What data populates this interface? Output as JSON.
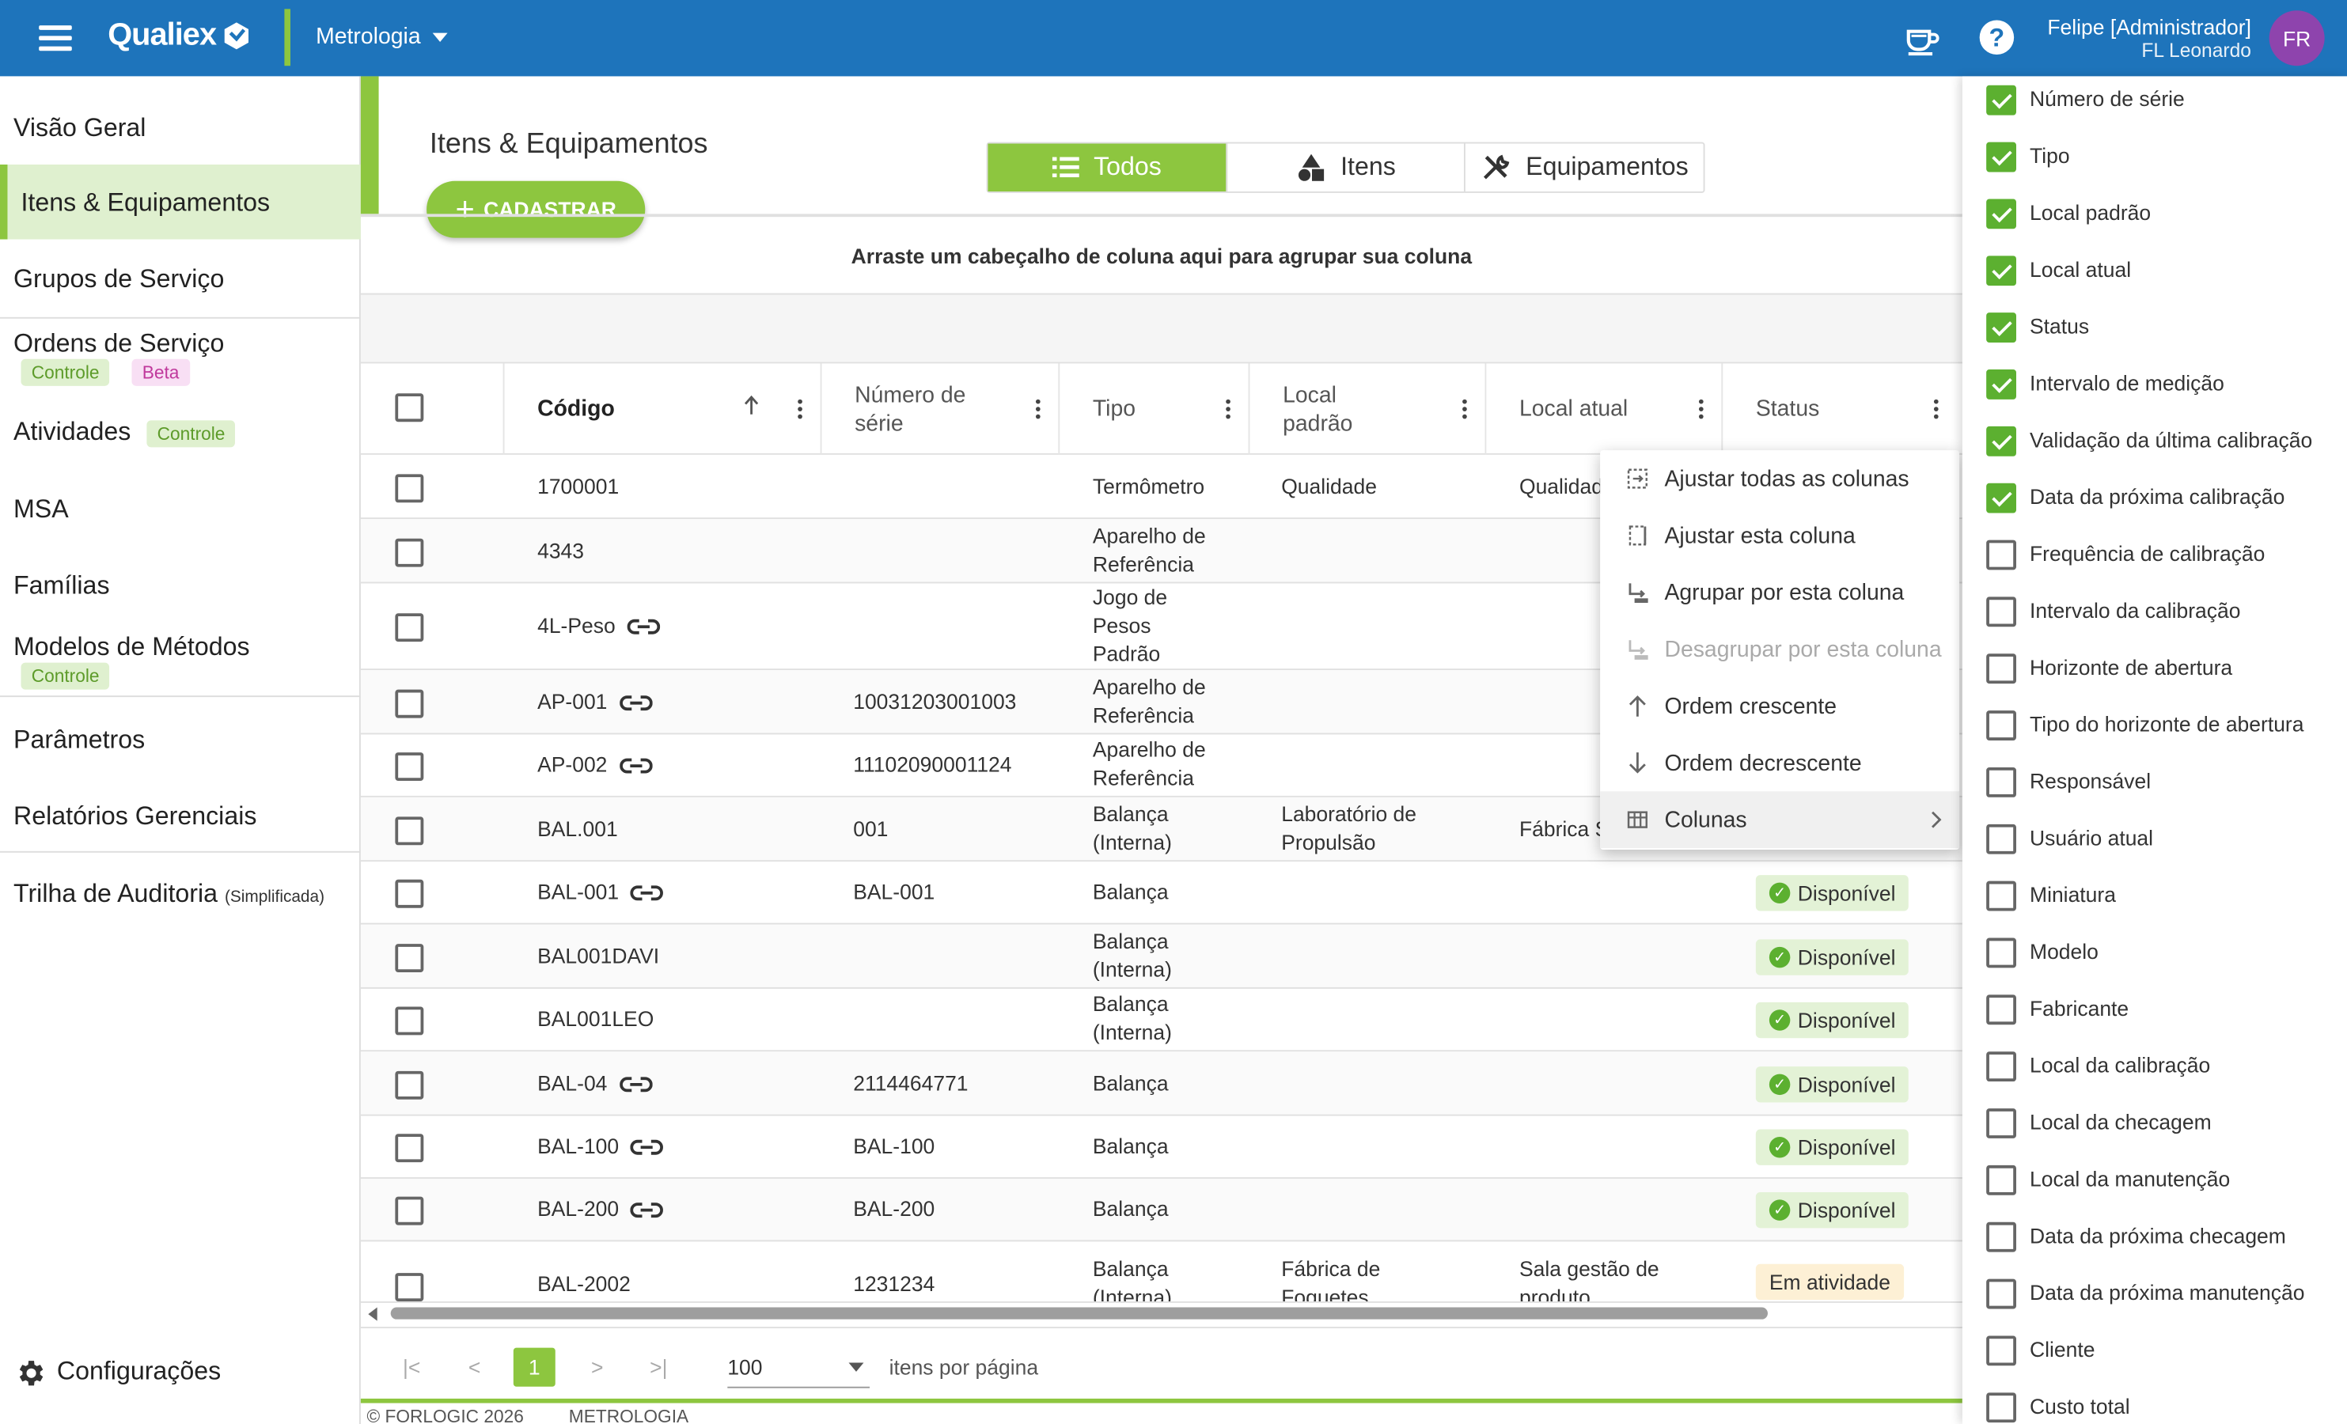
{
  "header": {
    "logo": "Qualiex",
    "module": "Metrologia",
    "user_name": "Felipe [Administrador]",
    "user_sub": "FL Leonardo",
    "avatar": "FR"
  },
  "sidebar": {
    "items": [
      {
        "label": "Visão Geral"
      },
      {
        "label": "Itens & Equipamentos"
      },
      {
        "label": "Grupos de Serviço"
      },
      {
        "label": "Ordens de Serviço",
        "tags": [
          "Controle",
          "Beta"
        ]
      },
      {
        "label": "Atividades",
        "tags": [
          "Controle"
        ]
      },
      {
        "label": "MSA"
      },
      {
        "label": "Famílias"
      },
      {
        "label": "Modelos de Métodos",
        "tags": [
          "Controle"
        ]
      },
      {
        "label": "Parâmetros"
      },
      {
        "label": "Relatórios Gerenciais"
      },
      {
        "label": "Trilha de Auditoria",
        "suffix": "(Simplificada)"
      }
    ],
    "settings": "Configurações"
  },
  "page": {
    "title": "Itens & Equipamentos",
    "add_button": "CADASTRAR",
    "toggle": [
      "Todos",
      "Itens",
      "Equipamentos"
    ],
    "group_hint": "Arraste um cabeçalho de coluna aqui para agrupar sua coluna"
  },
  "table": {
    "columns": [
      "Código",
      "Número de série",
      "Tipo",
      "Local padrão",
      "Local atual",
      "Status"
    ],
    "rows": [
      {
        "codigo": "1700001",
        "serie": "",
        "tipo": "Termômetro",
        "local_padrao": "Qualidade",
        "local_atual": "Qualidade",
        "status": ""
      },
      {
        "codigo": "4343",
        "serie": "",
        "tipo": "Aparelho de Referência",
        "local_padrao": "",
        "local_atual": "",
        "status": ""
      },
      {
        "codigo": "4L-Peso",
        "serie": "",
        "tipo": "Jogo de Pesos Padrão",
        "local_padrao": "",
        "local_atual": "",
        "status": ""
      },
      {
        "codigo": "AP-001",
        "serie": "10031203001003",
        "tipo": "Aparelho de Referência",
        "local_padrao": "",
        "local_atual": "",
        "status": ""
      },
      {
        "codigo": "AP-002",
        "serie": "11102090001124",
        "tipo": "Aparelho de Referência",
        "local_padrao": "",
        "local_atual": "",
        "status": ""
      },
      {
        "codigo": "BAL.001",
        "serie": "001",
        "tipo": "Balança (Interna)",
        "local_padrao": "Laboratório de Propulsão",
        "local_atual": "Fábrica S",
        "status": ""
      },
      {
        "codigo": "BAL-001",
        "serie": "BAL-001",
        "tipo": "Balança",
        "local_padrao": "",
        "local_atual": "",
        "status": "Disponível"
      },
      {
        "codigo": "BAL001DAVI",
        "serie": "",
        "tipo": "Balança (Interna)",
        "local_padrao": "",
        "local_atual": "",
        "status": "Disponível"
      },
      {
        "codigo": "BAL001LEO",
        "serie": "",
        "tipo": "Balança (Interna)",
        "local_padrao": "",
        "local_atual": "",
        "status": "Disponível"
      },
      {
        "codigo": "BAL-04",
        "serie": "2114464771",
        "tipo": "Balança",
        "local_padrao": "",
        "local_atual": "",
        "status": "Disponível"
      },
      {
        "codigo": "BAL-100",
        "serie": "BAL-100",
        "tipo": "Balança",
        "local_padrao": "",
        "local_atual": "",
        "status": "Disponível"
      },
      {
        "codigo": "BAL-200",
        "serie": "BAL-200",
        "tipo": "Balança",
        "local_padrao": "",
        "local_atual": "",
        "status": "Disponível"
      },
      {
        "codigo": "BAL-2002",
        "serie": "1231234",
        "tipo": "Balança (Interna)",
        "local_padrao": "Fábrica de Foguetes",
        "local_atual": "Sala gestão de produto",
        "status": "Em atividade"
      }
    ]
  },
  "pager": {
    "current_page": "1",
    "page_size": "100",
    "per_page_label": "itens por página"
  },
  "footer": {
    "copyright": "© FORLOGIC 2026",
    "module": "METROLOGIA"
  },
  "context_menu": {
    "items": [
      {
        "label": "Ajustar todas as colunas"
      },
      {
        "label": "Ajustar esta coluna"
      },
      {
        "label": "Agrupar por esta coluna"
      },
      {
        "label": "Desagrupar por esta coluna",
        "disabled": true
      },
      {
        "label": "Ordem crescente"
      },
      {
        "label": "Ordem decrescente"
      },
      {
        "label": "Colunas",
        "submenu": true
      }
    ]
  },
  "column_chooser": {
    "items": [
      {
        "label": "Número de série",
        "checked": true
      },
      {
        "label": "Tipo",
        "checked": true
      },
      {
        "label": "Local padrão",
        "checked": true
      },
      {
        "label": "Local atual",
        "checked": true
      },
      {
        "label": "Status",
        "checked": true
      },
      {
        "label": "Intervalo de medição",
        "checked": true
      },
      {
        "label": "Validação da última calibração",
        "checked": true
      },
      {
        "label": "Data da próxima calibração",
        "checked": true
      },
      {
        "label": "Frequência de calibração",
        "checked": false
      },
      {
        "label": "Intervalo da calibração",
        "checked": false
      },
      {
        "label": "Horizonte de abertura",
        "checked": false
      },
      {
        "label": "Tipo do horizonte de abertura",
        "checked": false
      },
      {
        "label": "Responsável",
        "checked": false
      },
      {
        "label": "Usuário atual",
        "checked": false
      },
      {
        "label": "Miniatura",
        "checked": false
      },
      {
        "label": "Modelo",
        "checked": false
      },
      {
        "label": "Fabricante",
        "checked": false
      },
      {
        "label": "Local da calibração",
        "checked": false
      },
      {
        "label": "Local da checagem",
        "checked": false
      },
      {
        "label": "Local da manutenção",
        "checked": false
      },
      {
        "label": "Data da próxima checagem",
        "checked": false
      },
      {
        "label": "Data da próxima manutenção",
        "checked": false
      },
      {
        "label": "Cliente",
        "checked": false
      },
      {
        "label": "Custo total",
        "checked": false
      }
    ]
  },
  "colors": {
    "brand_blue": "#1e74bb",
    "accent_green": "#8dc63f",
    "avatar": "#8e44ad"
  }
}
